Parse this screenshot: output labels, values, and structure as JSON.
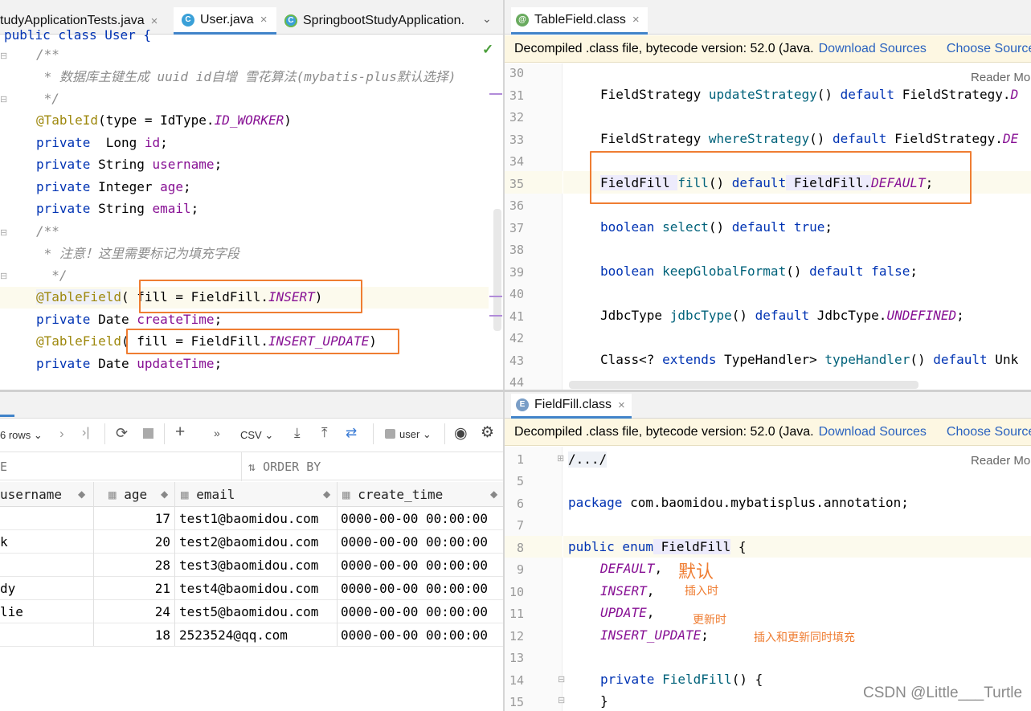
{
  "left_editor": {
    "tabs": [
      {
        "label": "tudyApplicationTests.java",
        "icon": "class-icon"
      },
      {
        "label": "User.java",
        "icon": "class-icon"
      },
      {
        "label": "SpringbootStudyApplication.",
        "icon": "spring-class-icon"
      }
    ],
    "code": {
      "l0": "public class User {",
      "l1": "/**",
      "l2": " * 数据库主键生成 uuid id自增 雪花算法(mybatis-plus默认选择)",
      "l3": " */",
      "anno1": "@TableId",
      "anno1_args_a": "(type = IdType.",
      "anno1_const": "ID_WORKER",
      "anno1_args_b": ")",
      "f1_kw": "private",
      "f1_type": "  Long ",
      "f1_name": "id",
      "f2_kw": "private",
      "f2_type": " String ",
      "f2_name": "username",
      "f3_kw": "private",
      "f3_type": " Integer ",
      "f3_name": "age",
      "f4_kw": "private",
      "f4_type": " String ",
      "f4_name": "email",
      "c2_a": "/**",
      "c2_b": " * 注意！这里需要标记为填充字段",
      "c2_c": "  */",
      "anno2": "@TableField",
      "anno2_args_a": "( fill = FieldFill.",
      "anno2_const": "INSERT",
      "anno2_args_b": ")",
      "f5_kw": "private",
      "f5_type": " Date ",
      "f5_name": "createTime",
      "anno3": "@TableField",
      "anno3_args_a": "( fill = FieldFill.",
      "anno3_const": "INSERT_UPDATE",
      "anno3_args_b": ")",
      "f6_kw": "private",
      "f6_type": " Date ",
      "f6_name": "updateTime",
      "semi": ";"
    }
  },
  "right_top": {
    "tab": "TableField.class",
    "banner_text": "Decompiled .class file, bytecode version: 52.0 (Java.",
    "download_sources": "Download Sources",
    "choose_sources": "Choose Source",
    "reader_mode": "Reader Mo",
    "line_numbers": [
      "30",
      "31",
      "32",
      "33",
      "34",
      "35",
      "36",
      "37",
      "38",
      "39",
      "40",
      "41",
      "42",
      "43",
      "44"
    ],
    "lines": {
      "l31_a": "FieldStrategy ",
      "l31_fn": "updateStrategy",
      "l31_b": "() ",
      "l31_kw": "default",
      "l31_c": " FieldStrategy.",
      "l31_d": "D",
      "l33_a": "FieldStrategy ",
      "l33_fn": "whereStrategy",
      "l33_b": "() ",
      "l33_kw": "default",
      "l33_c": " FieldStrategy.",
      "l33_d": "DE",
      "l35_a": "FieldFill ",
      "l35_fn": "fill",
      "l35_b": "() ",
      "l35_kw": "default",
      "l35_c": " FieldFill.",
      "l35_d": "DEFAULT",
      "l35_e": ";",
      "l37_kw": "boolean",
      "l37_fn": " select",
      "l37_b": "() ",
      "l37_kw2": "default",
      "l37_c": " true",
      "l37_e": ";",
      "l39_kw": "boolean",
      "l39_fn": " keepGlobalFormat",
      "l39_b": "() ",
      "l39_kw2": "default",
      "l39_c": " false",
      "l39_e": ";",
      "l41_a": "JdbcType ",
      "l41_fn": "jdbcType",
      "l41_b": "() ",
      "l41_kw": "default",
      "l41_c": " JdbcType.",
      "l41_d": "UNDEFINED",
      "l41_e": ";",
      "l43_a": "Class<? ",
      "l43_kw": "extends",
      "l43_b": " TypeHandler> ",
      "l43_fn": "typeHandler",
      "l43_c": "() ",
      "l43_kw2": "default",
      "l43_d": " Unk"
    }
  },
  "db": {
    "rows_label": "6 rows",
    "csv_label": "CSV",
    "user_label": "user",
    "where_label": "E",
    "order_by_label": "ORDER BY",
    "columns": [
      "username",
      "age",
      "email",
      "create_time"
    ],
    "rows": [
      {
        "username": "",
        "age": "17",
        "email": "test1@baomidou.com",
        "create_time": "0000-00-00 00:00:00"
      },
      {
        "username": "k",
        "age": "20",
        "email": "test2@baomidou.com",
        "create_time": "0000-00-00 00:00:00"
      },
      {
        "username": "",
        "age": "28",
        "email": "test3@baomidou.com",
        "create_time": "0000-00-00 00:00:00"
      },
      {
        "username": "dy",
        "age": "21",
        "email": "test4@baomidou.com",
        "create_time": "0000-00-00 00:00:00"
      },
      {
        "username": "lie",
        "age": "24",
        "email": "test5@baomidou.com",
        "create_time": "0000-00-00 00:00:00"
      },
      {
        "username": "",
        "age": "18",
        "email": "2523524@qq.com",
        "create_time": "0000-00-00 00:00:00"
      }
    ]
  },
  "right_bottom": {
    "tab": "FieldFill.class",
    "banner_text": "Decompiled .class file, bytecode version: 52.0 (Java.",
    "download_sources": "Download Sources",
    "choose_sources": "Choose Source",
    "reader_mode": "Reader Mo",
    "line_numbers": [
      "1",
      "5",
      "6",
      "7",
      "8",
      "9",
      "10",
      "11",
      "12",
      "13",
      "14",
      "15"
    ],
    "lines": {
      "l1": "/.../",
      "l6_kw": "package",
      "l6_rest": " com.baomidou.mybatisplus.annotation;",
      "l8_kw": "public enum",
      "l8_name": " FieldFill",
      "l8_rest": " {",
      "l9": "DEFAULT",
      "l10": "INSERT",
      "l11": "UPDATE",
      "l12": "INSERT_UPDATE",
      "comma": ",",
      "semi": ";",
      "l14_kw": "private",
      "l14_rest": " FieldFill",
      "l14_end": "() {",
      "l15": "}"
    },
    "notes": {
      "default": "默认",
      "insert": "插入时",
      "update": "更新时",
      "insert_update": "插入和更新同时填充"
    }
  },
  "watermark": "CSDN @Little___Turtle",
  "colors": {
    "keyword": "#0033b3",
    "field": "#871094",
    "annotation": "#9e880d",
    "comment": "#8c8c8c",
    "highlight_box": "#ef7d32",
    "link": "#2a62bf",
    "banner_bg": "#fdf7e2"
  }
}
